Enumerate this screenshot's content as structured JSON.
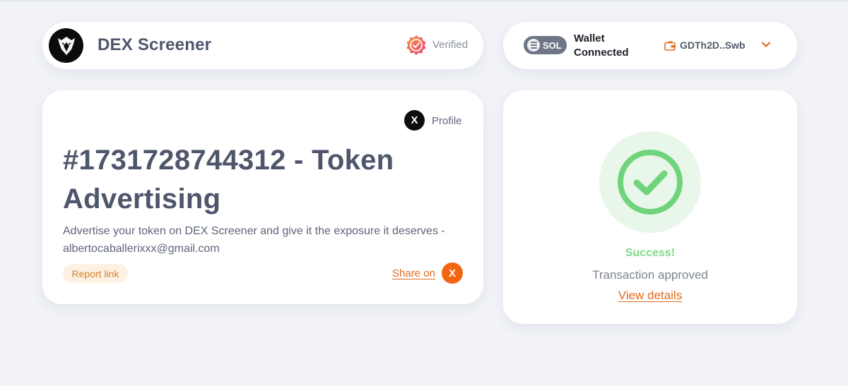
{
  "header": {
    "brand_name": "DEX Screener",
    "verified_label": "Verified",
    "logo_icon": "eagle-logo-icon",
    "verified_icon": "verified-badge-icon"
  },
  "wallet": {
    "network": "SOL",
    "status_line1": "Wallet",
    "status_line2": "Connected",
    "address": "GDTh2D..Swb",
    "wallet_icon": "wallet-icon",
    "dropdown_icon": "chevron-down-icon"
  },
  "main": {
    "profile_label": "Profile",
    "title": "#1731728744312 - Token Advertising",
    "description": "Advertise your token on DEX Screener and give it the exposure it deserves - albertocaballerixxx@gmail.com",
    "report_label": "Report link",
    "share_label": "Share on",
    "x_glyph": "X"
  },
  "status": {
    "title": "Success!",
    "message": "Transaction approved",
    "link": "View details",
    "icon": "check-circle-icon"
  },
  "colors": {
    "accent": "#e36a1e",
    "success": "#7fd98a",
    "text_dark": "#4d566b",
    "background": "#f1f3f8"
  }
}
